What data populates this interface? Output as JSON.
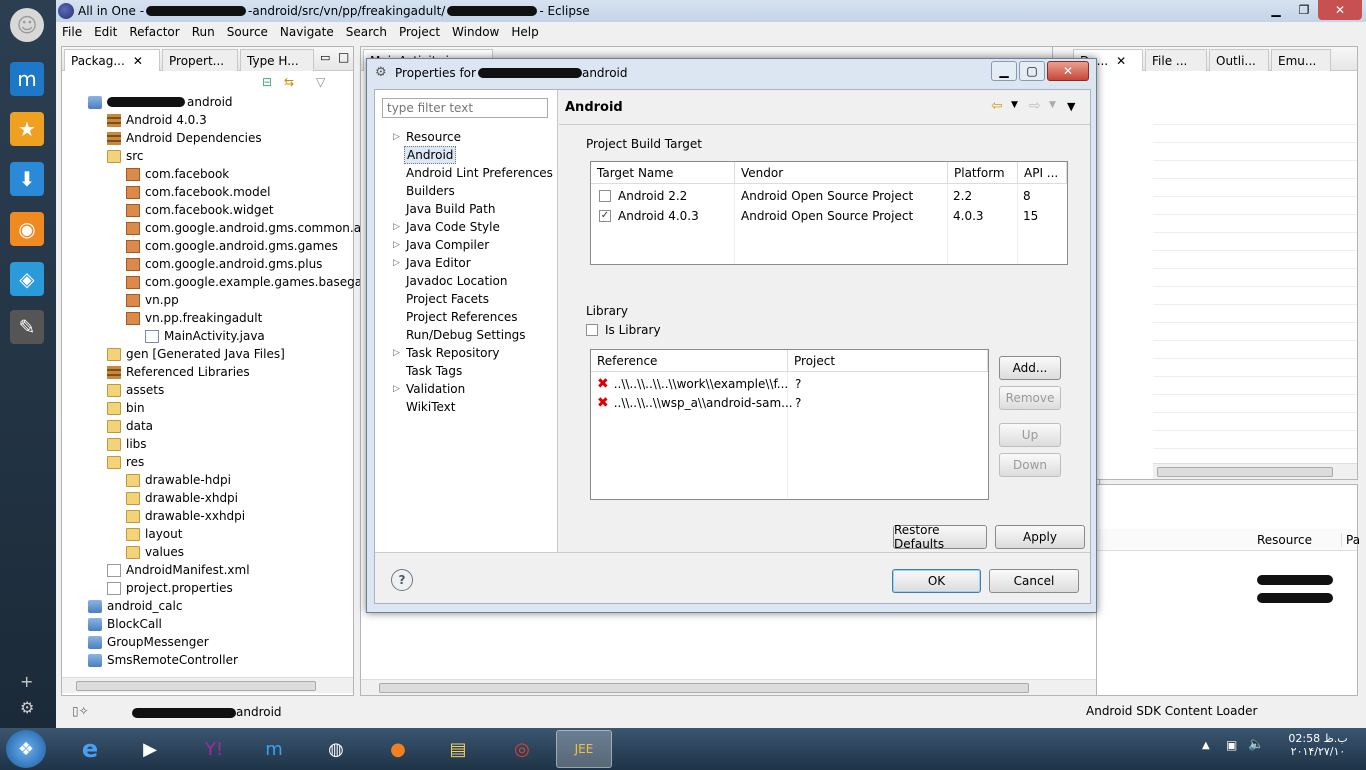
{
  "window": {
    "title_prefix": "All in One - ",
    "title_path": "-android/src/vn/pp/freakingadult/",
    "title_suffix": " - Eclipse"
  },
  "menu": [
    "File",
    "Edit",
    "Refactor",
    "Run",
    "Source",
    "Navigate",
    "Search",
    "Project",
    "Window",
    "Help"
  ],
  "left_tabs": [
    "Packag...",
    "Propert...",
    "Type H..."
  ],
  "package_tree": [
    {
      "label": "android",
      "icon": "proj",
      "indent": 0
    },
    {
      "label": "Android 4.0.3",
      "icon": "lib",
      "indent": 1
    },
    {
      "label": "Android Dependencies",
      "icon": "lib",
      "indent": 1
    },
    {
      "label": "src",
      "icon": "folder",
      "indent": 1
    },
    {
      "label": "com.facebook",
      "icon": "pkg",
      "indent": 2
    },
    {
      "label": "com.facebook.model",
      "icon": "pkg",
      "indent": 2
    },
    {
      "label": "com.facebook.widget",
      "icon": "pkg",
      "indent": 2
    },
    {
      "label": "com.google.android.gms.common.api",
      "icon": "pkg",
      "indent": 2
    },
    {
      "label": "com.google.android.gms.games",
      "icon": "pkg",
      "indent": 2
    },
    {
      "label": "com.google.android.gms.plus",
      "icon": "pkg",
      "indent": 2
    },
    {
      "label": "com.google.example.games.basegameu",
      "icon": "pkg",
      "indent": 2
    },
    {
      "label": "vn.pp",
      "icon": "pkg",
      "indent": 2
    },
    {
      "label": "vn.pp.freakingadult",
      "icon": "pkg",
      "indent": 2
    },
    {
      "label": "MainActivity.java",
      "icon": "java",
      "indent": 3
    },
    {
      "label": "gen [Generated Java Files]",
      "icon": "folder",
      "indent": 1
    },
    {
      "label": "Referenced Libraries",
      "icon": "lib",
      "indent": 1
    },
    {
      "label": "assets",
      "icon": "folder",
      "indent": 1
    },
    {
      "label": "bin",
      "icon": "folder",
      "indent": 1
    },
    {
      "label": "data",
      "icon": "folder",
      "indent": 1
    },
    {
      "label": "libs",
      "icon": "folder",
      "indent": 1
    },
    {
      "label": "res",
      "icon": "folder",
      "indent": 1
    },
    {
      "label": "drawable-hdpi",
      "icon": "folder",
      "indent": 2
    },
    {
      "label": "drawable-xhdpi",
      "icon": "folder",
      "indent": 2
    },
    {
      "label": "drawable-xxhdpi",
      "icon": "folder",
      "indent": 2
    },
    {
      "label": "layout",
      "icon": "folder",
      "indent": 2
    },
    {
      "label": "values",
      "icon": "folder",
      "indent": 2
    },
    {
      "label": "AndroidManifest.xml",
      "icon": "file",
      "indent": 1
    },
    {
      "label": "project.properties",
      "icon": "file",
      "indent": 1
    },
    {
      "label": "android_calc",
      "icon": "proj",
      "indent": 0
    },
    {
      "label": "BlockCall",
      "icon": "proj",
      "indent": 0
    },
    {
      "label": "GroupMessenger",
      "icon": "proj",
      "indent": 0
    },
    {
      "label": "SmsRemoteController",
      "icon": "proj",
      "indent": 0
    }
  ],
  "right_tabs": [
    "File ...",
    "Outli...",
    "Emu..."
  ],
  "editor_tab": "MainActivity.java",
  "resource_header": "Resource",
  "pa_header": "Pa",
  "status": {
    "left": "android",
    "right": "Android SDK Content Loader"
  },
  "dialog": {
    "title_prefix": "Properties for ",
    "title_suffix": "android",
    "filter_placeholder": "type filter text",
    "nav": [
      {
        "label": "Resource",
        "arrow": true
      },
      {
        "label": "Android",
        "arrow": false,
        "selected": true
      },
      {
        "label": "Android Lint Preferences",
        "arrow": false
      },
      {
        "label": "Builders",
        "arrow": false
      },
      {
        "label": "Java Build Path",
        "arrow": false
      },
      {
        "label": "Java Code Style",
        "arrow": true
      },
      {
        "label": "Java Compiler",
        "arrow": true
      },
      {
        "label": "Java Editor",
        "arrow": true
      },
      {
        "label": "Javadoc Location",
        "arrow": false
      },
      {
        "label": "Project Facets",
        "arrow": false
      },
      {
        "label": "Project References",
        "arrow": false
      },
      {
        "label": "Run/Debug Settings",
        "arrow": false
      },
      {
        "label": "Task Repository",
        "arrow": true
      },
      {
        "label": "Task Tags",
        "arrow": false
      },
      {
        "label": "Validation",
        "arrow": true
      },
      {
        "label": "WikiText",
        "arrow": false
      }
    ],
    "page_title": "Android",
    "build_target": {
      "label": "Project Build Target",
      "headers": [
        "Target Name",
        "Vendor",
        "Platform",
        "API ..."
      ],
      "rows": [
        {
          "name": "Android 2.2",
          "vendor": "Android Open Source Project",
          "platform": "2.2",
          "api": "8",
          "checked": false
        },
        {
          "name": "Android 4.0.3",
          "vendor": "Android Open Source Project",
          "platform": "4.0.3",
          "api": "15",
          "checked": true
        }
      ]
    },
    "library": {
      "label": "Library",
      "is_library": "Is Library",
      "headers": [
        "Reference",
        "Project"
      ],
      "rows": [
        {
          "reference": "..\\\\..\\\\..\\\\..\\\\work\\\\example\\\\f...",
          "project": "?"
        },
        {
          "reference": "..\\\\..\\\\..\\\\wsp_a\\\\android-sam...",
          "project": "?"
        }
      ],
      "buttons": {
        "add": "Add...",
        "remove": "Remove",
        "up": "Up",
        "down": "Down"
      }
    },
    "restore_defaults": "Restore Defaults",
    "apply": "Apply",
    "ok": "OK",
    "cancel": "Cancel"
  },
  "clock": {
    "time": "02:58 ب.ظ",
    "date": "۲۰۱۴/۲۷/۱۰"
  }
}
